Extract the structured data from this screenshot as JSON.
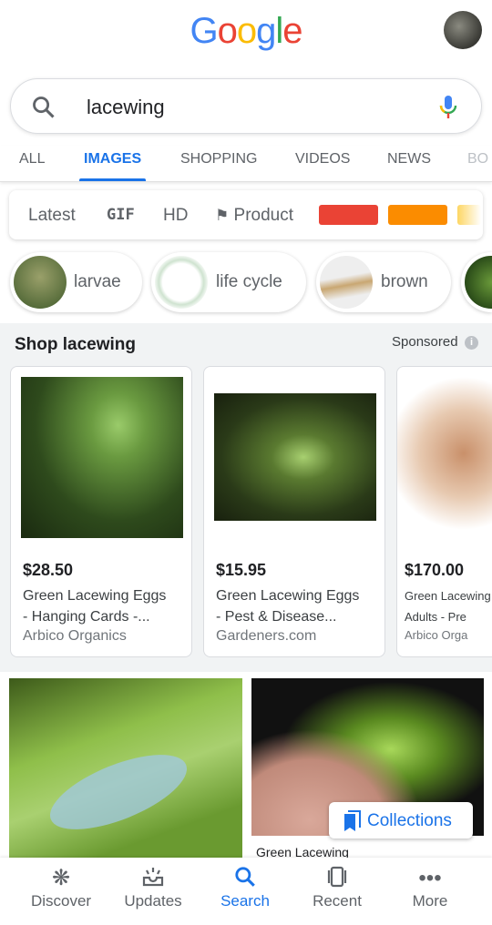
{
  "header": {
    "logo": "Google"
  },
  "search": {
    "query": "lacewing"
  },
  "tabs": [
    "ALL",
    "IMAGES",
    "SHOPPING",
    "VIDEOS",
    "NEWS",
    "BO"
  ],
  "filters": {
    "items": [
      "Latest",
      "GIF",
      "HD",
      "Product"
    ],
    "colors": [
      "#ea4335",
      "#fb8c00",
      "#fdd663"
    ]
  },
  "chips": [
    "larvae",
    "life cycle",
    "brown"
  ],
  "shop": {
    "title": "Shop lacewing",
    "sponsored": "Sponsored",
    "products": [
      {
        "price": "$28.50",
        "title": "Green Lacewing Eggs\n- Hanging Cards -...",
        "seller": "Arbico Organics"
      },
      {
        "price": "$15.95",
        "title": "Green Lacewing Eggs\n- Pest & Disease...",
        "seller": "Gardeners.com"
      },
      {
        "price": "$170.00",
        "title": "Green Lacewing\nAdults - Pre",
        "seller": "Arbico Orga"
      }
    ]
  },
  "results": {
    "caption": "Green Lacewing",
    "collections": "Collections"
  },
  "bottom_nav": [
    {
      "label": "Discover",
      "icon": "asterisk-icon"
    },
    {
      "label": "Updates",
      "icon": "updates-icon"
    },
    {
      "label": "Search",
      "icon": "search-icon"
    },
    {
      "label": "Recent",
      "icon": "recent-icon"
    },
    {
      "label": "More",
      "icon": "more-icon"
    }
  ]
}
